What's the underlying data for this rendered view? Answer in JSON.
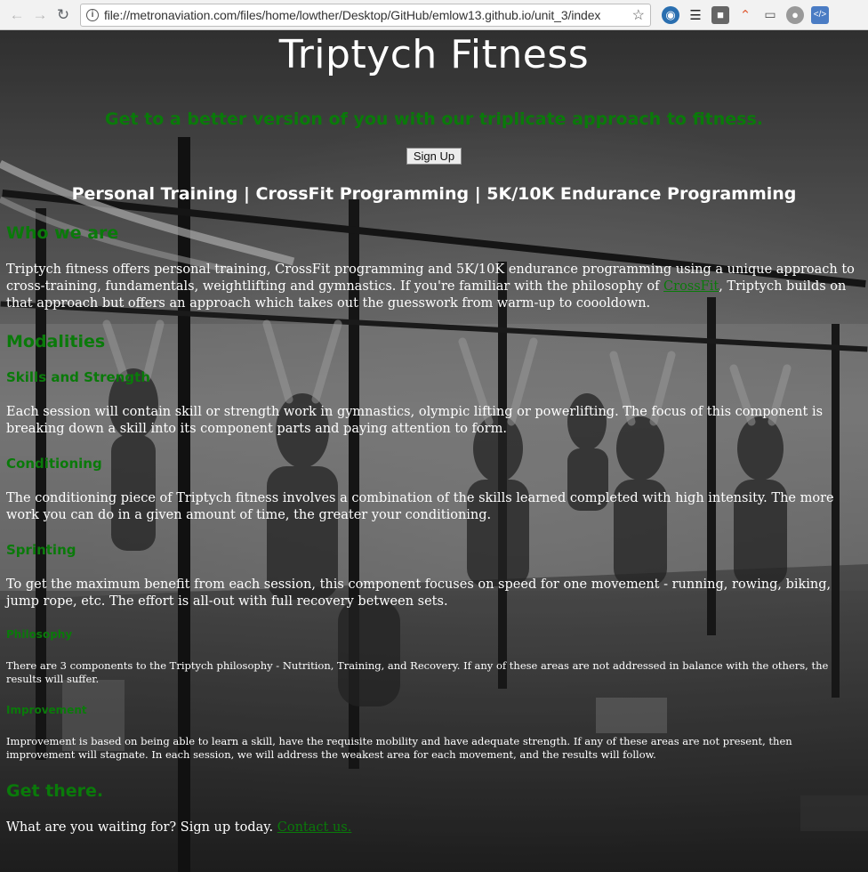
{
  "browser": {
    "url": "file://metronaviation.com/files/home/lowther/Desktop/GitHub/emlow13.github.io/unit_3/index"
  },
  "header": {
    "title": "Triptych Fitness",
    "tagline": "Get to a better version of you with our triplicate approach to fitness.",
    "signup_label": "Sign Up",
    "services": "Personal Training | CrossFit Programming | 5K/10K Endurance Programming"
  },
  "about": {
    "heading": "Who we are",
    "text_before_link": "Triptych fitness offers personal training, CrossFit programming and 5K/10K endurance programming using a unique approach to cross-training, fundamentals, weightlifting and gymnastics. If you're familiar with the philosophy of ",
    "link": "CrossFit",
    "text_after_link": ", Triptych builds on that approach but offers an approach which takes out the guesswork from warm-up to coooldown."
  },
  "modalities": {
    "heading": "Modalities",
    "skills_heading": "Skills and Strength",
    "skills_text": "Each session will contain skill or strength work in gymnastics, olympic lifting or powerlifting. The focus of this component is breaking down a skill into its component parts and paying attention to form.",
    "conditioning_heading": "Conditioning",
    "conditioning_text": "The conditioning piece of Triptych fitness involves a combination of the skills learned completed with high intensity. The more work you can do in a given amount of time, the greater your conditioning.",
    "sprinting_heading": "Sprinting",
    "sprinting_text": "To get the maximum benefit from each session, this component focuses on speed for one movement - running, rowing, biking, jump rope, etc. The effort is all-out with full recovery between sets.",
    "philosophy_heading": "Philosophy",
    "philosophy_text": "There are 3 components to the Triptych philosophy - Nutrition, Training, and Recovery. If any of these areas are not addressed in balance with the others, the results will suffer.",
    "improvement_heading": "Improvement",
    "improvement_text": "Improvement is based on being able to learn a skill, have the requisite mobility and have adequate strength. If any of these areas are not present, then improvement will stagnate. In each session, we will address the weakest area for each movement, and the results will follow."
  },
  "cta": {
    "heading": "Get there.",
    "text": "What are you waiting for? Sign up today. ",
    "link": "Contact us."
  },
  "colors": {
    "accent_green": "#0a7a0a",
    "text_white": "#ffffff"
  }
}
